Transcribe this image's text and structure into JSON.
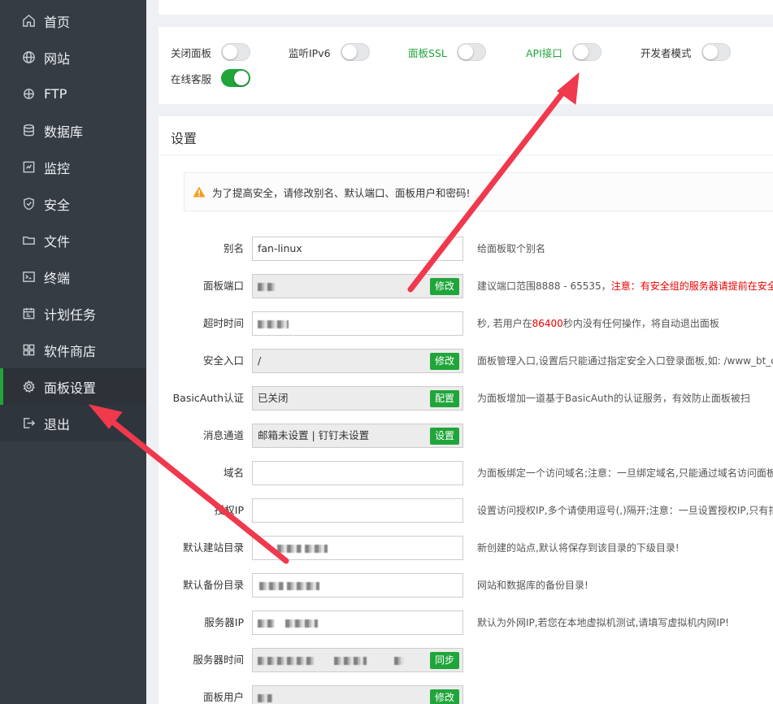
{
  "sidebar": {
    "items": [
      {
        "label": "首页",
        "icon": "home-icon"
      },
      {
        "label": "网站",
        "icon": "globe-icon"
      },
      {
        "label": "FTP",
        "icon": "ftp-icon"
      },
      {
        "label": "数据库",
        "icon": "database-icon"
      },
      {
        "label": "监控",
        "icon": "monitor-icon"
      },
      {
        "label": "安全",
        "icon": "shield-icon"
      },
      {
        "label": "文件",
        "icon": "folder-icon"
      },
      {
        "label": "终端",
        "icon": "terminal-icon"
      },
      {
        "label": "计划任务",
        "icon": "calendar-icon"
      },
      {
        "label": "软件商店",
        "icon": "grid-icon"
      },
      {
        "label": "面板设置",
        "icon": "gear-icon"
      },
      {
        "label": "退出",
        "icon": "logout-icon"
      }
    ],
    "active": "面板设置"
  },
  "toggles": [
    {
      "label": "关闭面板",
      "on": false
    },
    {
      "label": "监听IPv6",
      "on": false
    },
    {
      "label": "面板SSL",
      "on": false
    },
    {
      "label": "API接口",
      "on": false
    },
    {
      "label": "开发者模式",
      "on": false
    },
    {
      "label": "在线客服",
      "on": true
    }
  ],
  "settings": {
    "title": "设置",
    "warning": "为了提高安全，请修改别名、默认端口、面板用户和密码!",
    "rows": [
      {
        "label": "别名",
        "value": "fan-linux",
        "readonly": false,
        "button": "",
        "hint": "给面板取个别名"
      },
      {
        "label": "面板端口",
        "value": "",
        "readonly": true,
        "button": "修改",
        "hint": "建议端口范围8888 - 65535，",
        "hint_red": "注意：有安全组的服务器请提前在安全组"
      },
      {
        "label": "超时时间",
        "value": "",
        "readonly": false,
        "button": "",
        "hint_pre": "秒, 若用户在",
        "hint_red": "86400",
        "hint_post": "秒内没有任何操作，将自动退出面板"
      },
      {
        "label": "安全入口",
        "value": "/",
        "readonly": true,
        "button": "修改",
        "hint": "面板管理入口,设置后只能通过指定安全入口登录面板,如: /www_bt_cn"
      },
      {
        "label": "BasicAuth认证",
        "value": "已关闭",
        "readonly": true,
        "button": "配置",
        "hint": "为面板增加一道基于BasicAuth的认证服务，有效防止面板被扫"
      },
      {
        "label": "消息通道",
        "value": "邮箱未设置 | 钉钉未设置",
        "readonly": true,
        "button": "设置",
        "hint": ""
      },
      {
        "label": "域名",
        "value": "",
        "readonly": false,
        "button": "",
        "hint": "为面板绑定一个访问域名;注意：一旦绑定域名,只能通过域名访问面板"
      },
      {
        "label": "授权IP",
        "value": "",
        "readonly": false,
        "button": "",
        "hint": "设置访问授权IP,多个请使用逗号(,)隔开;注意：一旦设置授权IP,只有指"
      },
      {
        "label": "默认建站目录",
        "value": "",
        "readonly": false,
        "button": "",
        "hint": "新创建的站点,默认将保存到该目录的下级目录!"
      },
      {
        "label": "默认备份目录",
        "value": "",
        "readonly": false,
        "button": "",
        "hint": "网站和数据库的备份目录!"
      },
      {
        "label": "服务器IP",
        "value": "",
        "readonly": false,
        "button": "",
        "hint": "默认为外网IP,若您在本地虚拟机测试,请填写虚拟机内网IP!"
      },
      {
        "label": "服务器时间",
        "value": "",
        "readonly": true,
        "button": "同步",
        "hint": ""
      },
      {
        "label": "面板用户",
        "value": "",
        "readonly": true,
        "button": "修改",
        "hint": ""
      }
    ]
  },
  "colors": {
    "accent": "#20a53a",
    "sidebar": "#353c44",
    "arrow": "#f0394d"
  }
}
